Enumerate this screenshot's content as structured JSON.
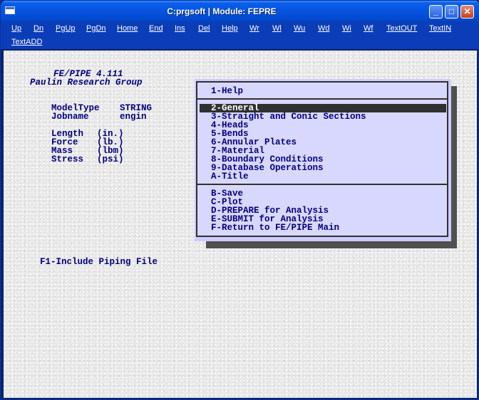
{
  "window": {
    "title": "C:prgsoft | Module: FEPRE",
    "minimize_symbol": "_",
    "maximize_symbol": "□",
    "close_symbol": "✕"
  },
  "menubar": {
    "items": [
      "Up",
      "Dn",
      "PgUp",
      "PgDn",
      "Home",
      "End",
      "Ins",
      "Del",
      "Help",
      "Wr",
      "Wl",
      "Wu",
      "Wd",
      "Wi",
      "Wf",
      "TextOUT",
      "TextIN",
      "TextADD"
    ]
  },
  "header": {
    "line1": "FE/PIPE 4.111",
    "line2": "Paulin Research Group"
  },
  "model": {
    "type_label": "ModelType",
    "type_value": "STRING",
    "jobname_label": "Jobname",
    "jobname_value": "engin"
  },
  "units": [
    {
      "label": "Length",
      "unit": "(in.)"
    },
    {
      "label": "Force",
      "unit": "(lb.)"
    },
    {
      "label": "Mass",
      "unit": "(lbm)"
    },
    {
      "label": "Stress",
      "unit": "(psi)"
    }
  ],
  "function_key": "F1-Include Piping File",
  "menu": {
    "help": "1-Help",
    "sections": [
      "2-General",
      "3-Straight and Conic Sections",
      "4-Heads",
      "5-Bends",
      "6-Annular Plates",
      "7-Material",
      "8-Boundary Conditions",
      "9-Database Operations",
      "A-Title"
    ],
    "selected_index": 0,
    "actions": [
      "B-Save",
      "C-Plot",
      "D-PREPARE for Analysis",
      "E-SUBMIT for Analysis",
      "F-Return to FE/PIPE Main"
    ]
  },
  "colors": {
    "text": "#000080",
    "menu_background": "#D8D8FF",
    "selection": "#303030",
    "titlebar": "#0453E0"
  }
}
